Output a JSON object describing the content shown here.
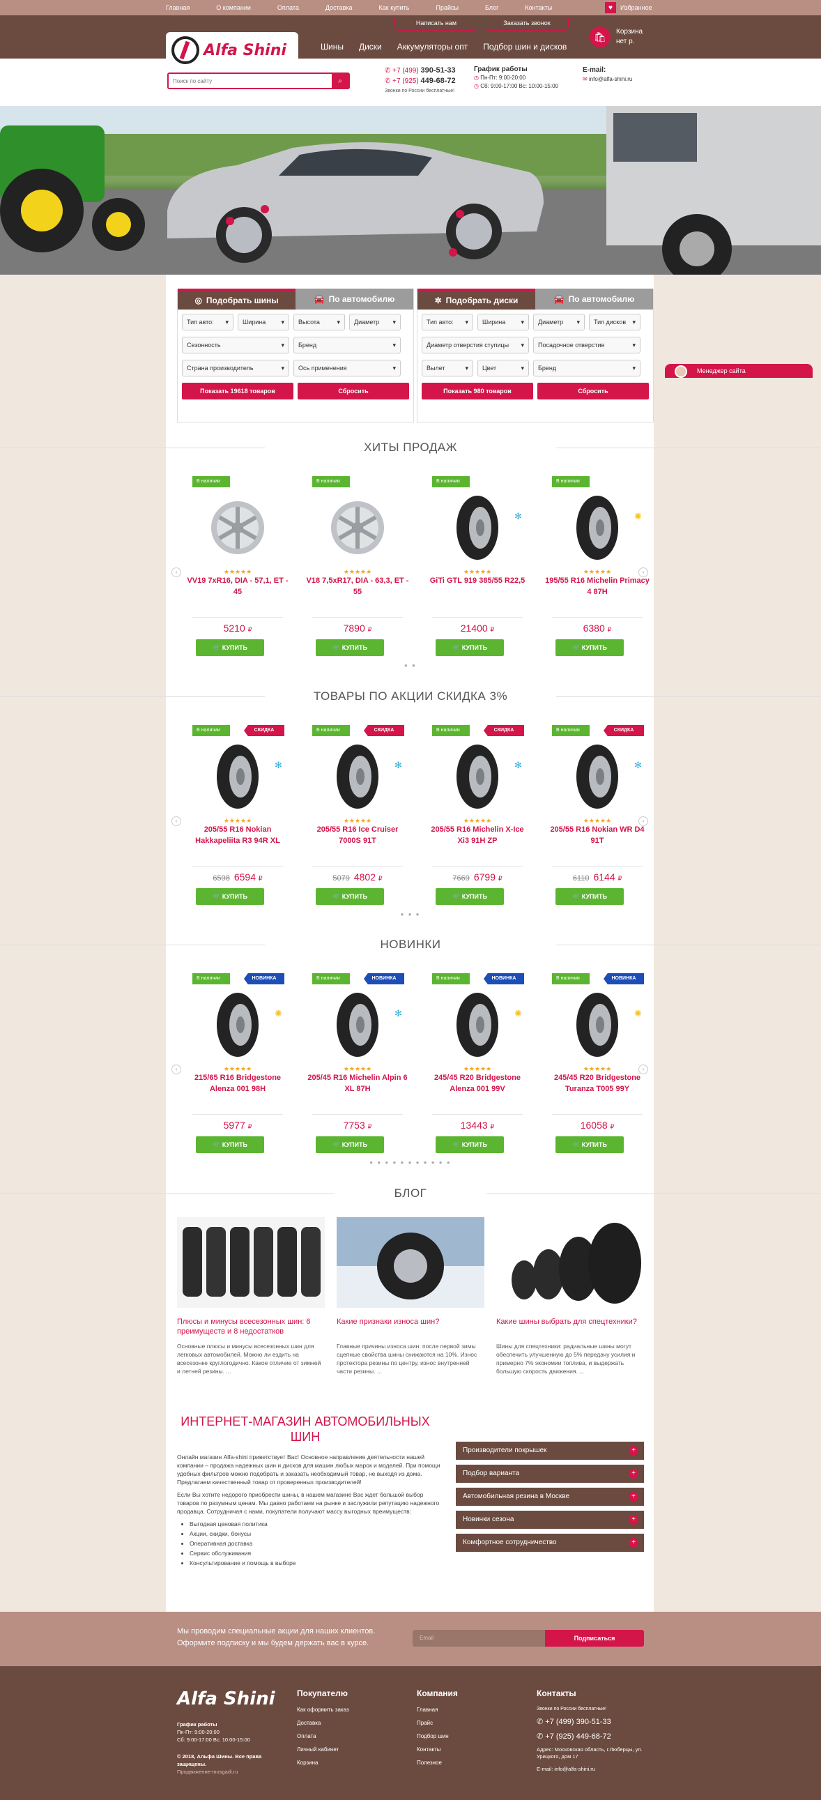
{
  "topnav": [
    "Главная",
    "О компании",
    "Оплата",
    "Доставка",
    "Как купить",
    "Прайсы",
    "Блог",
    "Контакты"
  ],
  "favorites": "Избранное",
  "header_buttons": [
    "Написать нам",
    "Заказать звонок"
  ],
  "logo_text": "Alfa Shini",
  "mainnav": [
    "Шины",
    "Диски",
    "Аккумуляторы опт",
    "Подбор шин и дисков"
  ],
  "cart": {
    "title": "Корзина",
    "sub": "нет  р."
  },
  "search": {
    "placeholder": "Поиск по сайту"
  },
  "phones": {
    "p1_code": "+7 (499)",
    "p1": "390-51-33",
    "p2_code": "+7 (925)",
    "p2": "449-68-72",
    "note": "Звонки по России бесплатные!"
  },
  "schedule": {
    "title": "График работы",
    "l1": "Пн-Пт: 9:00-20:00",
    "l2": "Сб: 9:00-17:00 Вс: 10:00-15:00"
  },
  "email": {
    "title": "E-mail:",
    "value": "info@alfa-shini.ru"
  },
  "filters": {
    "tires": {
      "tab_a": "Подобрать шины",
      "tab_b": "По автомобилю",
      "rows": [
        [
          "Тип авто:",
          "Ширина",
          "Высота",
          "Диаметр"
        ],
        [
          "Сезонность",
          "Бренд"
        ],
        [
          "Страна производитель",
          "Ось применения"
        ]
      ],
      "show": "Показать 19618 товаров",
      "reset": "Сбросить"
    },
    "disks": {
      "tab_a": "Подобрать диски",
      "tab_b": "По автомобилю",
      "rows": [
        [
          "Тип авто:",
          "Ширина",
          "Диаметр",
          "Тип дисков"
        ],
        [
          "Диаметр отверстия ступицы",
          "Посадочное отверстие"
        ],
        [
          "Вылет",
          "Цвет",
          "Бренд"
        ]
      ],
      "show": "Показать 980 товаров",
      "reset": "Сбросить"
    }
  },
  "manager": "Менеджер сайта",
  "sections": {
    "hits": {
      "title": "ХИТЫ ПРОДАЖ",
      "products": [
        {
          "stock": "В наличии",
          "name": "VV19 7xR16, DIA - 57,1, ET - 45",
          "price": "5210",
          "season": ""
        },
        {
          "stock": "В наличии",
          "name": "V18 7,5xR17, DIA - 63,3, ET - 55",
          "price": "7890",
          "season": ""
        },
        {
          "stock": "В наличии",
          "name": "GiTi GTL 919 385/55 R22,5",
          "price": "21400",
          "season": "snow"
        },
        {
          "stock": "В наличии",
          "name": "195/55 R16 Michelin Primacy 4 87H",
          "price": "6380",
          "season": "sun"
        }
      ]
    },
    "sale": {
      "title": "ТОВАРЫ ПО АКЦИИ СКИДКА 3%",
      "tag": "СКИДКА",
      "products": [
        {
          "stock": "В наличии",
          "name": "205/55 R16 Nokian Hakkapeliita R3 94R XL",
          "old": "6598",
          "price": "6594",
          "season": "snow"
        },
        {
          "stock": "В наличии",
          "name": "205/55 R16 Ice Cruiser 7000S 91T",
          "old": "5079",
          "price": "4802",
          "season": "snow"
        },
        {
          "stock": "В наличии",
          "name": "205/55 R16 Michelin X-Ice Xi3 91H ZP",
          "old": "7669",
          "price": "6799",
          "season": "snow"
        },
        {
          "stock": "В наличии",
          "name": "205/55 R16 Nokian WR D4 91T",
          "old": "6110",
          "price": "6144",
          "season": "snow"
        }
      ]
    },
    "new": {
      "title": "НОВИНКИ",
      "tag": "НОВИНКА",
      "products": [
        {
          "stock": "В наличии",
          "name": "215/65 R16 Bridgestone Alenza 001 98H",
          "price": "5977",
          "season": "sun"
        },
        {
          "stock": "В наличии",
          "name": "205/45 R16 Michelin Alpin 6 XL 87H",
          "price": "7753",
          "season": "snow"
        },
        {
          "stock": "В наличии",
          "name": "245/45 R20 Bridgestone Alenza 001 99V",
          "price": "13443",
          "season": "sun"
        },
        {
          "stock": "В наличии",
          "name": "245/45 R20 Bridgestone Turanza T005 99Y",
          "price": "16058",
          "season": "sun"
        }
      ]
    }
  },
  "buy_label": "КУПИТЬ",
  "currency": "₽",
  "blog": {
    "title": "БЛОГ",
    "posts": [
      {
        "title": "Плюсы и минусы всесезонных шин: 6 преимуществ и 8 недостатков",
        "text": "Основные плюсы и минусы всесезонных шин для легковых автомобилей. Можно ли ездить на всесезонке круглогодично. Какое отличие от зимней и летней резины. ..."
      },
      {
        "title": "Какие признаки износа шин?",
        "text": "Главные причины износа шин: после первой зимы сцепные свойства шины снижаются на 10%. Износ протектора резины по центру, износ внутренней части резины. ..."
      },
      {
        "title": "Какие шины выбрать для спецтехники?",
        "text": "Шины для спецтехники: радиальные шины могут обеспечить улучшенную до 5% передачу усилия и примерно 7% экономии топлива, и выдержать большую скорость движения. ..."
      }
    ]
  },
  "about": {
    "title": "ИНТЕРНЕТ-МАГАЗИН АВТОМОБИЛЬНЫХ ШИН",
    "p1": "Онлайн магазин Alfa-shini приветствует Вас! Основное направление деятельности нашей компании – продажа надежных шин и дисков для машин любых марок и моделей. При помощи удобных фильтров можно подобрать и заказать необходимый товар, не выходя из дома. Предлагаем качественный товар от проверенных производителей!",
    "p2": "Если Вы хотите недорого приобрести шины, в нашем магазине Вас ждет большой выбор товаров по разумным ценам. Мы давно работаем на рынке и заслужили репутацию надежного продавца. Сотрудничая с нами, покупатели получают массу выгодных преимуществ:",
    "list": [
      "Выгодная ценовая политика",
      "Акции, скидки, бонусы",
      "Оперативная доставка",
      "Сервис обслуживания",
      "Консультирование и помощь в выборе"
    ],
    "accordion": [
      "Производители покрышек",
      "Подбор варианта",
      "Автомобильная резина в Москве",
      "Новинки сезона",
      "Комфортное сотрудничество"
    ]
  },
  "subscribe": {
    "text1": "Мы проводим специальные акции для наших клиентов.",
    "text2": "Оформите подписку и мы будем держать вас в курсе.",
    "placeholder": "Email",
    "button": "Подписаться"
  },
  "footer": {
    "logo": "Alfa Shini",
    "sched_title": "График работы",
    "sched1": "Пн-Пт: 9:00-20:00",
    "sched2": "Сб: 9:00-17:00 Вс: 10:00-15:00",
    "copy1": "© 2018, Альфа Шины. Все права",
    "copy2": "защищены.",
    "promo": "Продвижение-mosgadi.ru",
    "buyer_title": "Покупателю",
    "buyer": [
      "Как оформить заказ",
      "Доставка",
      "Оплата",
      "Личный кабинет",
      "Корзина"
    ],
    "company_title": "Компания",
    "company": [
      "Главная",
      "Прайс",
      "Подбор шин",
      "Контакты",
      "Полезное"
    ],
    "contacts_title": "Контакты",
    "free": "Звонки по России бесплатные!",
    "p1": "+7 (499) 390-51-33",
    "p2": "+7 (925) 449-68-72",
    "addr": "Адрес: Московская область, г.Люберцы, ул. Урицкого, дом 17",
    "mail": "E-mail: info@alfa-shini.ru"
  }
}
